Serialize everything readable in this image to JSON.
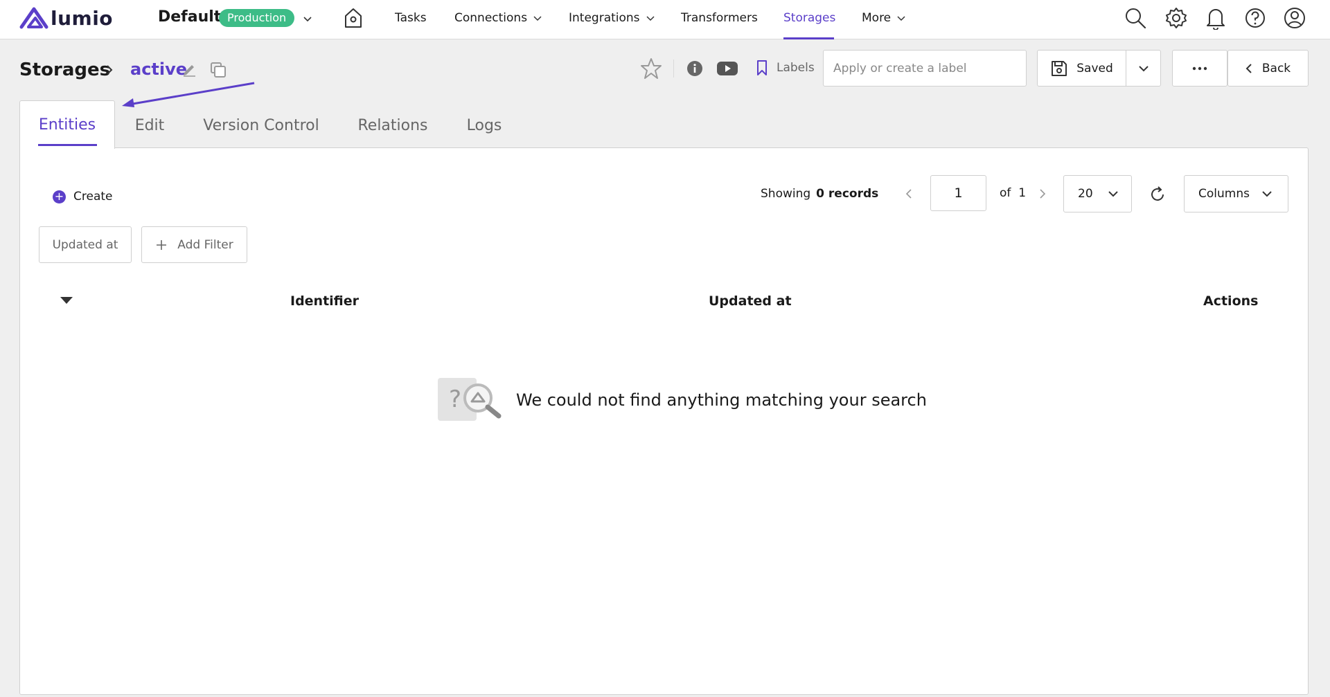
{
  "brand": {
    "name": "lumio",
    "accent": "#5b3fc9",
    "success": "#3dbc87"
  },
  "env": {
    "name": "Default",
    "badge": "Production"
  },
  "nav": {
    "tasks": "Tasks",
    "connections": "Connections",
    "integrations": "Integrations",
    "transformers": "Transformers",
    "storages": "Storages",
    "more": "More"
  },
  "header": {
    "title": "Storages",
    "current": "active",
    "labels": "Labels",
    "label_placeholder": "Apply or create a label",
    "saved": "Saved",
    "back": "Back"
  },
  "tabs": [
    "Entities",
    "Edit",
    "Version Control",
    "Relations",
    "Logs"
  ],
  "toolbar": {
    "create": "Create",
    "showing_prefix": "Showing",
    "showing_count": "0 records",
    "page": "1",
    "of": "of",
    "total_pages": "1",
    "per_page": "20",
    "columns": "Columns"
  },
  "filters": {
    "updated_at": "Updated at",
    "add_filter": "Add Filter"
  },
  "table": {
    "columns": [
      "Identifier",
      "Updated at",
      "Actions"
    ]
  },
  "empty": {
    "message": "We could not find anything matching your search"
  },
  "icons": [
    "home-icon",
    "search-icon",
    "gear-icon",
    "bell-icon",
    "help-icon",
    "user-icon",
    "star-icon",
    "info-icon",
    "youtube-icon",
    "bookmark-icon",
    "save-icon",
    "refresh-icon"
  ]
}
